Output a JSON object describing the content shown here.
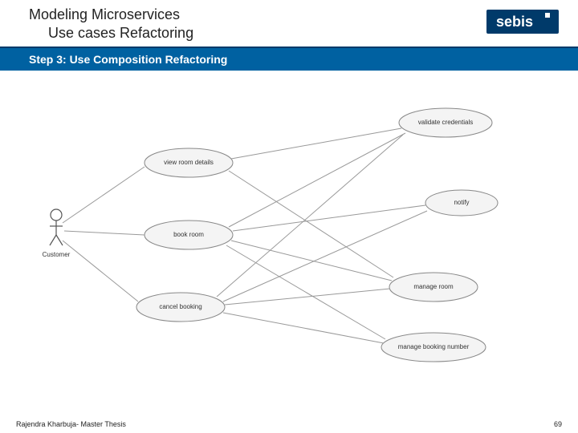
{
  "header": {
    "title_main": "Modeling Microservices",
    "title_sub": "Use cases Refactoring",
    "logo_text": "sebis"
  },
  "bar": {
    "step_label": "Step 3: Use Composition Refactoring"
  },
  "diagram": {
    "actor_label": "Customer",
    "usecases": {
      "view_room_details": "view room details",
      "book_room": "book room",
      "cancel_booking": "cancel booking",
      "validate_credentials": "validate credentials",
      "notify": "notify",
      "manage_room": "manage room",
      "manage_booking_number": "manage booking number"
    }
  },
  "footer": {
    "author_line": "Rajendra Kharbuja- Master Thesis",
    "page_number": "69"
  }
}
